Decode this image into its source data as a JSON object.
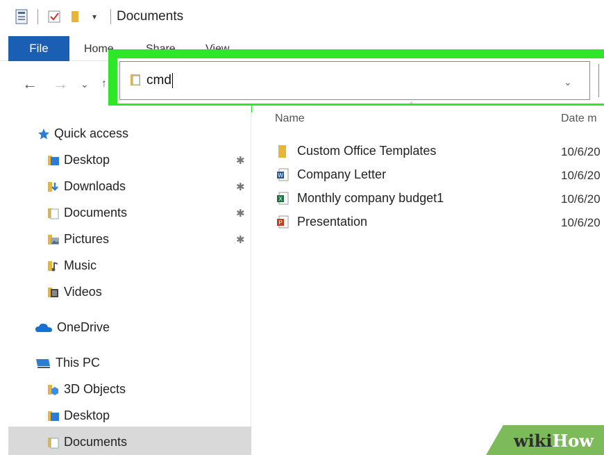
{
  "window": {
    "title": "Documents"
  },
  "ribbon": {
    "tabs": [
      "File",
      "Home",
      "Share",
      "View"
    ]
  },
  "address_bar": {
    "value": "cmd"
  },
  "nav_pane": {
    "quick_access": {
      "label": "Quick access"
    },
    "quick_items": [
      {
        "label": "Desktop",
        "pinned": true
      },
      {
        "label": "Downloads",
        "pinned": true
      },
      {
        "label": "Documents",
        "pinned": true
      },
      {
        "label": "Pictures",
        "pinned": true
      },
      {
        "label": "Music",
        "pinned": false
      },
      {
        "label": "Videos",
        "pinned": false
      }
    ],
    "onedrive": {
      "label": "OneDrive"
    },
    "this_pc": {
      "label": "This PC"
    },
    "pc_items": [
      {
        "label": "3D Objects"
      },
      {
        "label": "Desktop"
      },
      {
        "label": "Documents",
        "selected": true
      }
    ]
  },
  "columns": {
    "name": "Name",
    "date": "Date m"
  },
  "files": [
    {
      "name": "Custom Office Templates",
      "date": "10/6/20",
      "icon": "folder-icon"
    },
    {
      "name": "Company Letter",
      "date": "10/6/20",
      "icon": "word-doc-icon"
    },
    {
      "name": "Monthly company budget1",
      "date": "10/6/20",
      "icon": "excel-doc-icon"
    },
    {
      "name": "Presentation",
      "date": "10/6/20",
      "icon": "powerpoint-doc-icon"
    }
  ],
  "watermark": {
    "prefix": "wiki",
    "suffix": "How"
  },
  "colors": {
    "highlight": "#2ee62a",
    "file_tab": "#1a5fb4",
    "watermark": "#7cba5a"
  }
}
